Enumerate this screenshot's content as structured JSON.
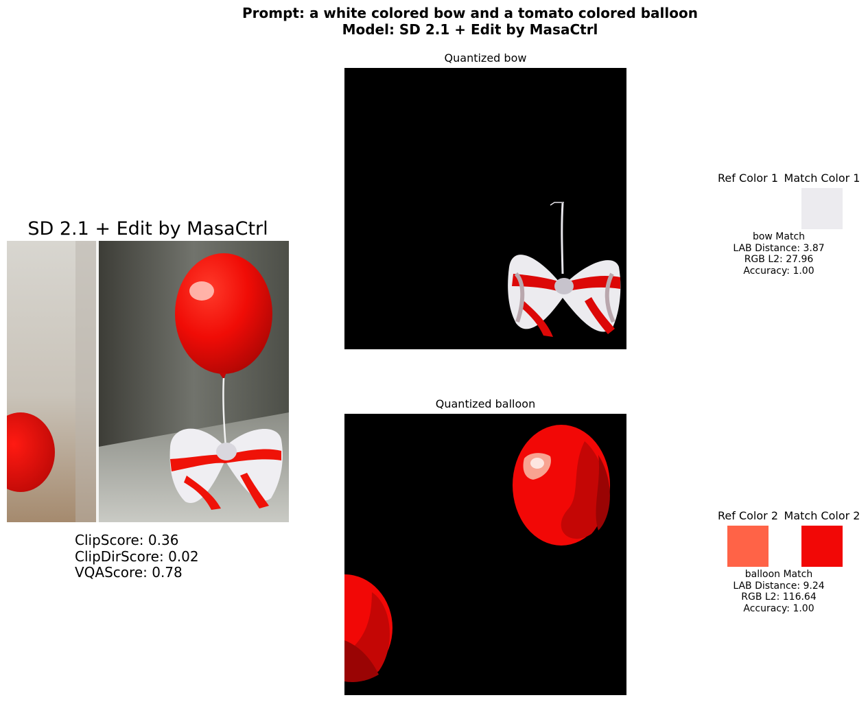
{
  "figure": {
    "suptitle_line1": "Prompt: a white colored bow and a tomato colored balloon",
    "suptitle_line2": "Model: SD 2.1 + Edit by MasaCtrl"
  },
  "left_panel": {
    "title": "SD 2.1 + Edit by MasaCtrl",
    "scores": [
      "ClipScore: 0.36",
      "ClipDirScore: 0.02",
      "VQAScore: 0.78"
    ]
  },
  "quantized_panels": [
    {
      "title": "Quantized bow"
    },
    {
      "title": "Quantized balloon"
    }
  ],
  "color_matches": [
    {
      "ref_label": "Ref Color 1",
      "match_label": "Match Color 1",
      "ref_color": null,
      "match_color": "#ecebef",
      "caption": [
        "bow Match",
        "LAB Distance: 3.87",
        "RGB L2: 27.96",
        "Accuracy: 1.00"
      ]
    },
    {
      "ref_label": "Ref Color 2",
      "match_label": "Match Color 2",
      "ref_color": "#ff6347",
      "match_color": "#f20806",
      "caption": [
        "balloon Match",
        "LAB Distance: 9.24",
        "RGB L2: 116.64",
        "Accuracy: 1.00"
      ]
    }
  ]
}
